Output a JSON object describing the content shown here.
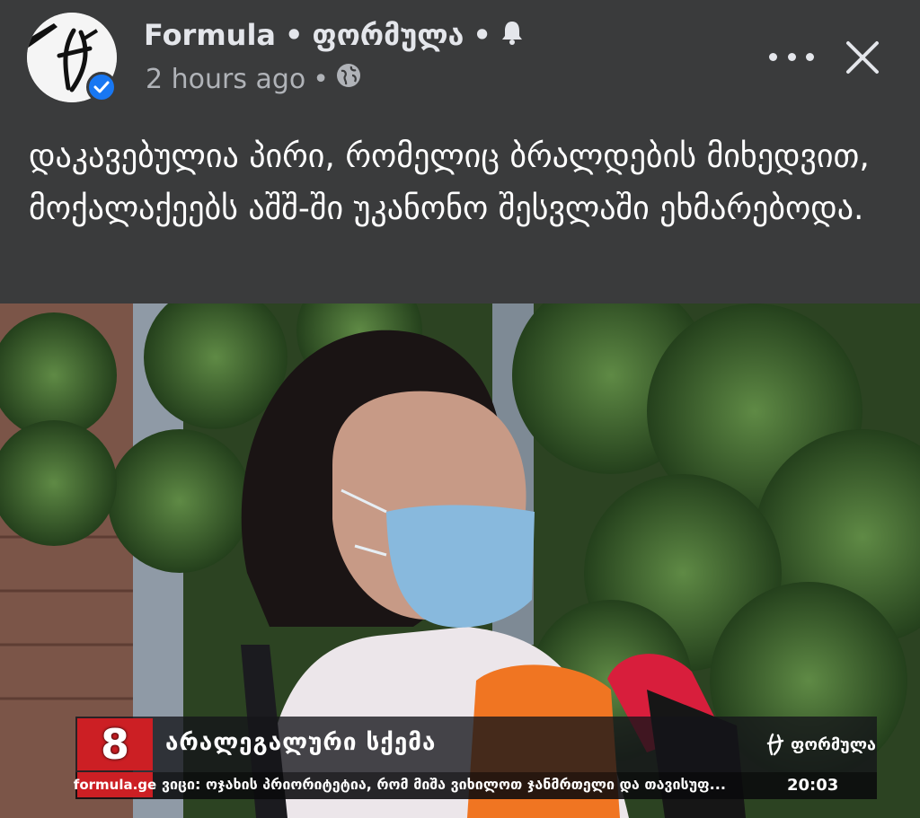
{
  "post": {
    "page_name": "Formula",
    "page_name_geo": "ფორმულა",
    "separator": "•",
    "time": "2 hours ago",
    "text": "დაკავებულია პირი, რომელიც ბრალდების მიხედვით, მოქალაქეებს აშშ-ში უკანონო შესვლაში ეხმარებოდა."
  },
  "icons": {
    "avatar": "formula-logo-avatar",
    "verified": "verified-badge-icon",
    "notifications": "bell-icon",
    "audience": "globe-icon",
    "more": "more-options-icon",
    "close": "close-icon"
  },
  "broadcast": {
    "channel_number": "8",
    "site": "formula.ge",
    "headline": "არალეგალური სქემა",
    "brand": "ფორმულა",
    "ticker": "ვიცი: ოჯახის პრიორიტეტია, რომ მიშა ვიხილოთ ჯანმრთელი და თავისუფ...",
    "clock": "20:03"
  },
  "colors": {
    "background": "#3a3b3c",
    "accent_blue": "#1877f2",
    "broadcast_red": "#cc1f24"
  }
}
